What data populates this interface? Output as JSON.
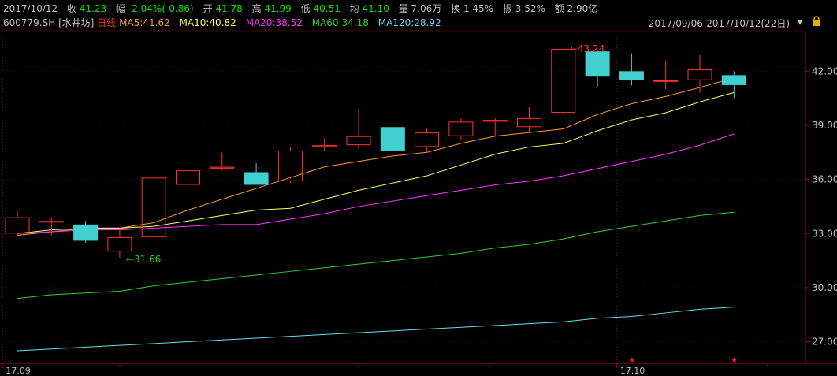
{
  "header": {
    "date": "2017/10/12",
    "close_label": "收",
    "close": "41.23",
    "change_label": "幅",
    "change": "-2.04%(-0.86)",
    "open_label": "开",
    "open": "41.78",
    "high_label": "高",
    "high": "41.99",
    "low_label": "低",
    "low": "40.51",
    "avg_label": "均",
    "avg": "41.10",
    "vol_label": "量",
    "vol": "7.06万",
    "turnover_label": "换",
    "turnover": "1.45%",
    "amplitude_label": "振",
    "amplitude": "3.52%",
    "amount_label": "额",
    "amount": "2.90亿"
  },
  "legend": {
    "symbol": "600779.SH [水井坊]",
    "period": "日线",
    "ma5": "MA5:41.62",
    "ma10": "MA10:40.82",
    "ma20": "MA20:38.52",
    "ma60": "MA60:34.18",
    "ma120": "MA120:28.92",
    "range": "2017/09/06-2017/10/12(22日)",
    "arrow": "▾"
  },
  "icons": {
    "lock": "lock-icon",
    "dropdown": "chevron-down-icon"
  },
  "colors": {
    "up": "#ff3232",
    "down": "#40d0d0",
    "ma5": "#ff9933",
    "ma10": "#ffff66",
    "ma20": "#ff33ff",
    "ma60": "#33cc33",
    "ma120": "#66ddee",
    "axis": "#b00000"
  },
  "chart_data": {
    "type": "candlestick",
    "dates": [
      "2017-09-06",
      "2017-09-07",
      "2017-09-08",
      "2017-09-11",
      "2017-09-12",
      "2017-09-13",
      "2017-09-14",
      "2017-09-15",
      "2017-09-18",
      "2017-09-19",
      "2017-09-20",
      "2017-09-21",
      "2017-09-22",
      "2017-09-25",
      "2017-09-26",
      "2017-09-27",
      "2017-09-28",
      "2017-09-29",
      "2017-10-09",
      "2017-10-10",
      "2017-10-11",
      "2017-10-12"
    ],
    "ohlc": [
      [
        33.0,
        34.3,
        32.9,
        33.9
      ],
      [
        33.7,
        33.9,
        32.9,
        33.7
      ],
      [
        33.5,
        33.7,
        32.5,
        32.6
      ],
      [
        32.0,
        33.3,
        31.66,
        32.8
      ],
      [
        32.8,
        36.1,
        32.8,
        36.1
      ],
      [
        35.7,
        38.3,
        35.1,
        36.5
      ],
      [
        36.6,
        37.5,
        36.5,
        36.7
      ],
      [
        36.4,
        36.9,
        35.7,
        35.7
      ],
      [
        35.9,
        37.8,
        35.8,
        37.6
      ],
      [
        37.8,
        38.3,
        37.6,
        37.9
      ],
      [
        37.9,
        39.9,
        37.7,
        38.4
      ],
      [
        38.9,
        38.9,
        37.6,
        37.6
      ],
      [
        37.8,
        38.8,
        37.5,
        38.6
      ],
      [
        38.4,
        39.4,
        38.2,
        39.2
      ],
      [
        39.2,
        39.4,
        38.4,
        39.3
      ],
      [
        38.9,
        40.0,
        38.6,
        39.4
      ],
      [
        39.7,
        43.24,
        39.6,
        43.24
      ],
      [
        43.1,
        43.2,
        41.1,
        41.7
      ],
      [
        42.0,
        43.0,
        41.2,
        41.5
      ],
      [
        41.5,
        42.6,
        41.0,
        41.5
      ],
      [
        41.5,
        42.9,
        40.8,
        42.1
      ],
      [
        41.78,
        41.99,
        40.51,
        41.23
      ]
    ],
    "ma": [
      {
        "name": "MA5",
        "values": [
          32.9,
          33.1,
          33.3,
          33.3,
          33.6,
          34.3,
          34.9,
          35.5,
          36.1,
          36.7,
          37.0,
          37.3,
          37.5,
          38.0,
          38.4,
          38.6,
          38.8,
          39.6,
          40.2,
          40.6,
          41.1,
          41.62
        ]
      },
      {
        "name": "MA10",
        "values": [
          33.0,
          33.2,
          33.3,
          33.3,
          33.4,
          33.7,
          34.0,
          34.3,
          34.4,
          34.9,
          35.4,
          35.8,
          36.2,
          36.8,
          37.4,
          37.8,
          38.0,
          38.7,
          39.3,
          39.7,
          40.3,
          40.82
        ]
      },
      {
        "name": "MA20",
        "values": [
          33.0,
          33.1,
          33.2,
          33.2,
          33.3,
          33.4,
          33.5,
          33.5,
          33.8,
          34.1,
          34.5,
          34.8,
          35.1,
          35.4,
          35.7,
          35.9,
          36.2,
          36.6,
          37.0,
          37.4,
          37.9,
          38.52
        ]
      },
      {
        "name": "MA60",
        "values": [
          29.4,
          29.6,
          29.7,
          29.8,
          30.1,
          30.3,
          30.5,
          30.7,
          30.9,
          31.1,
          31.3,
          31.5,
          31.7,
          31.9,
          32.2,
          32.4,
          32.7,
          33.1,
          33.4,
          33.7,
          34.0,
          34.18
        ]
      },
      {
        "name": "MA120",
        "values": [
          26.5,
          26.6,
          26.7,
          26.8,
          26.9,
          27.0,
          27.1,
          27.2,
          27.3,
          27.4,
          27.5,
          27.6,
          27.7,
          27.8,
          27.9,
          28.0,
          28.1,
          28.3,
          28.4,
          28.6,
          28.8,
          28.92
        ]
      }
    ],
    "yticks": [
      "27.00",
      "30.00",
      "33.00",
      "36.00",
      "39.00",
      "42.00"
    ],
    "ylim": [
      25.8,
      44.2
    ],
    "xticks": [
      {
        "index": 0,
        "label": "17.09"
      },
      {
        "index": 18,
        "label": "17.10"
      }
    ],
    "annotations": [
      {
        "index": 16,
        "value": 43.24,
        "label": "43.24",
        "color": "#ff3232"
      },
      {
        "index": 3,
        "value": 31.66,
        "label": "31.66",
        "color": "#00e600"
      }
    ],
    "markers": [
      {
        "index": 18,
        "label": "★"
      },
      {
        "index": 21,
        "label": "★"
      }
    ]
  }
}
